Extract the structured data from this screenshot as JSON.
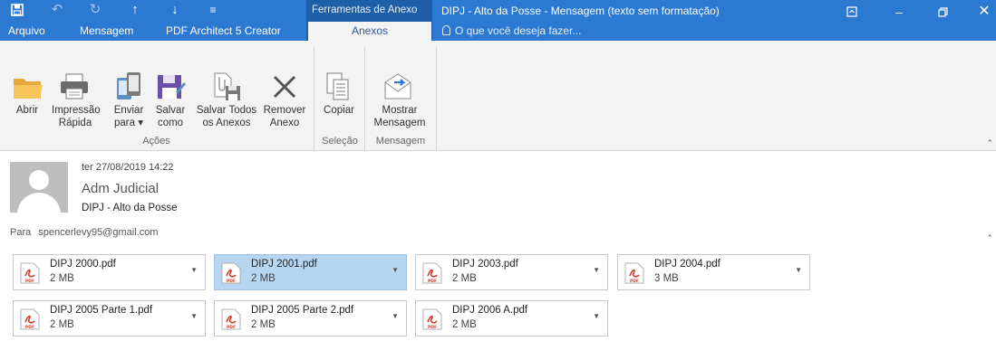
{
  "window": {
    "context_group": "Ferramentas de Anexo",
    "title": "DIPJ - Alto da Posse  -  Mensagem (texto sem formatação)"
  },
  "tabs": {
    "arquivo": "Arquivo",
    "mensagem": "Mensagem",
    "pdf_architect": "PDF Architect 5 Creator",
    "anexos": "Anexos",
    "tell_me": "O que você deseja fazer..."
  },
  "ribbon": {
    "abrir": "Abrir",
    "impressao_1": "Impressão",
    "impressao_2": "Rápida",
    "enviar_1": "Enviar",
    "enviar_2": "para ▾",
    "salvar_1": "Salvar",
    "salvar_2": "como",
    "salvar_todos_1": "Salvar Todos",
    "salvar_todos_2": "os Anexos",
    "remover_1": "Remover",
    "remover_2": "Anexo",
    "copiar": "Copiar",
    "mostrar_1": "Mostrar",
    "mostrar_2": "Mensagem",
    "group_acoes": "Ações",
    "group_selecao": "Seleção",
    "group_mensagem": "Mensagem"
  },
  "message": {
    "date": "ter 27/08/2019 14:22",
    "sender": "Adm Judicial",
    "subject": "DIPJ - Alto da Posse",
    "to_label": "Para",
    "to_address": "spencerlevy95@gmail.com"
  },
  "attachments": [
    {
      "name": "DIPJ 2000.pdf",
      "size": "2 MB"
    },
    {
      "name": "DIPJ 2001.pdf",
      "size": "2 MB"
    },
    {
      "name": "DIPJ 2003.pdf",
      "size": "2 MB"
    },
    {
      "name": "DIPJ 2004.pdf",
      "size": "3 MB"
    },
    {
      "name": "DIPJ 2005 Parte 1.pdf",
      "size": "2 MB"
    },
    {
      "name": "DIPJ 2005 Parte 2.pdf",
      "size": "2 MB"
    },
    {
      "name": "DIPJ 2006 A.pdf",
      "size": "2 MB"
    }
  ],
  "icons": {
    "save": "save-icon",
    "undo": "undo-icon",
    "redo": "redo-icon",
    "up": "arrow-up-icon",
    "down": "arrow-down-icon",
    "customize": "customize-qat-icon",
    "pdf": "pdf-file-icon"
  },
  "colors": {
    "titlebar": "#2b79d0",
    "context_group": "#1e5fa8",
    "ribbon": "#f3f3f3",
    "selected_attachment": "#b5d5f1",
    "pdf_red": "#d23b2b"
  }
}
